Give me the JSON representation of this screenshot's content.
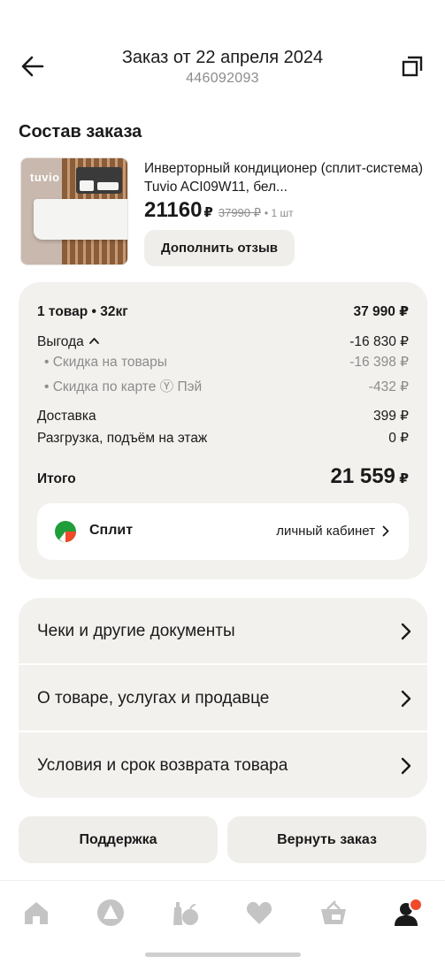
{
  "header": {
    "title": "Заказ от 22 апреля 2024",
    "order_number": "446092093"
  },
  "section_title": "Состав заказа",
  "product": {
    "thumb_brand": "tuvio",
    "name": "Инверторный кондиционер (сплит-система) Tuvio ACI09W11, бел...",
    "price": "21160",
    "currency": "₽",
    "old_price": "37990 ₽",
    "quantity": "• 1 шт",
    "review_button": "Дополнить отзыв"
  },
  "summary": {
    "items": {
      "label": "1 товар • 32кг",
      "value": "37 990 ₽"
    },
    "benefit": {
      "label": "Выгода",
      "value": "-16 830 ₽"
    },
    "discount_goods": {
      "label": "• Скидка на товары",
      "value": "-16 398 ₽"
    },
    "discount_card": {
      "label": "• Скидка по карте Ⓨ Пэй",
      "value": "-432 ₽"
    },
    "delivery": {
      "label": "Доставка",
      "value": "399 ₽"
    },
    "unloading": {
      "label": "Разгрузка, подъём на этаж",
      "value": "0 ₽"
    },
    "total": {
      "label": "Итого",
      "value": "21 559",
      "currency": "₽"
    },
    "split": {
      "name": "Сплит",
      "link": "личный кабинет"
    }
  },
  "links": [
    {
      "label": "Чеки и другие документы"
    },
    {
      "label": "О товаре, услугах и продавце"
    },
    {
      "label": "Условия и срок возврата товара"
    }
  ],
  "buttons": {
    "support": "Поддержка",
    "return": "Вернуть заказ"
  },
  "tabbar": {
    "icons": [
      "home-icon",
      "assistant-icon",
      "catalog-icon",
      "favorites-icon",
      "cart-icon",
      "profile-icon"
    ],
    "notification_color": "#f04a2a"
  },
  "colors": {
    "card_background": "#f3f1ee",
    "button_background": "#f0eeeb",
    "muted_text": "#8c8c8c",
    "tab_icon": "#c4c4c4",
    "split_green": "#1f9e3a",
    "split_red": "#f04a2a"
  }
}
